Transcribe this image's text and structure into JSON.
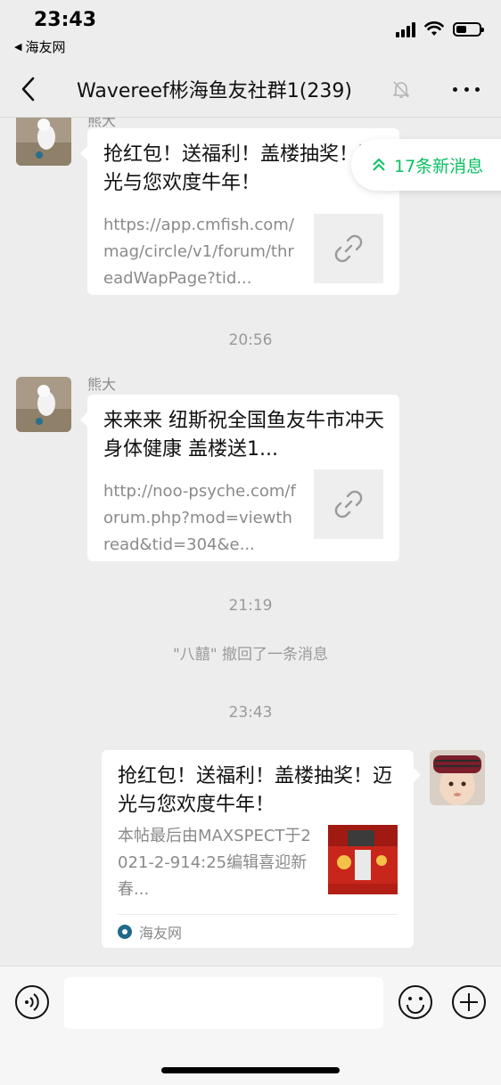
{
  "status_bar": {
    "time": "23:43",
    "back_app": "海友网"
  },
  "nav": {
    "title": "Wavereef彬海鱼友社群1(239)"
  },
  "new_messages_pill": "17条新消息",
  "messages": [
    {
      "sender": "熊大",
      "title": "抢红包！送福利！盖楼抽奖！迈光与您欢度牛年！",
      "desc": "https://app.cmfish.com/mag/circle/v1/forum/threadWapPage?tid..."
    },
    {
      "sender": "熊大",
      "title": "来来来 纽斯祝全国鱼友牛市冲天 身体健康 盖楼送1...",
      "desc": "http://noo-psyche.com/forum.php?mod=viewthread&tid=304&e..."
    },
    {
      "title": "抢红包！送福利！盖楼抽奖！迈光与您欢度牛年！",
      "desc": "本帖最后由MAXSPECT于2021-2-914:25编辑喜迎新春...",
      "source": "海友网"
    }
  ],
  "timestamps": [
    "20:56",
    "21:19",
    "23:43"
  ],
  "system_message": "\"八囍\" 撤回了一条消息",
  "colors": {
    "accent_green": "#07c160",
    "chat_background": "#ededed",
    "bubble": "#ffffff"
  },
  "icons": [
    "back-chevron-icon",
    "mute-bell-icon",
    "more-icon",
    "link-icon",
    "voice-icon",
    "emoji-icon",
    "add-icon"
  ]
}
